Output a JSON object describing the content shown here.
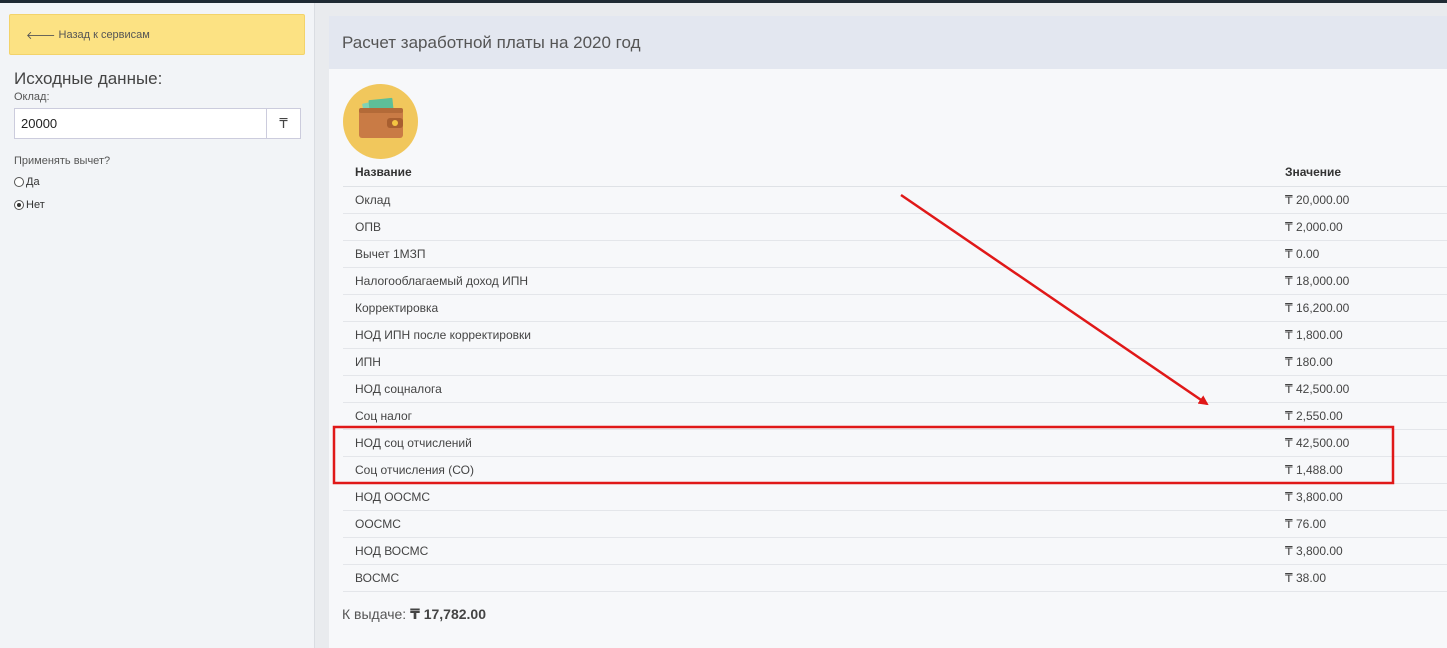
{
  "sidebar": {
    "back_label": "Назад к сервисам",
    "back_icon": "arrow-left-icon",
    "section_title": "Исходные данные:",
    "salary_label": "Оклад:",
    "salary_value": "20000",
    "currency_symbol": "₸",
    "deduction_question": "Применять вычет?",
    "options": [
      {
        "label": "Да",
        "checked": false
      },
      {
        "label": "Нет",
        "checked": true
      }
    ]
  },
  "main": {
    "title": "Расчет заработной платы на 2020 год",
    "icon": "wallet-icon",
    "table": {
      "headers": [
        "Название",
        "Значение"
      ],
      "rows": [
        {
          "name": "Оклад",
          "value": "₸ 20,000.00"
        },
        {
          "name": "ОПВ",
          "value": "₸ 2,000.00"
        },
        {
          "name": "Вычет 1МЗП",
          "value": "₸ 0.00"
        },
        {
          "name": "Налогооблагаемый доход ИПН",
          "value": "₸ 18,000.00"
        },
        {
          "name": "Корректировка",
          "value": "₸ 16,200.00"
        },
        {
          "name": "НОД ИПН после корректировки",
          "value": "₸ 1,800.00"
        },
        {
          "name": "ИПН",
          "value": "₸ 180.00"
        },
        {
          "name": "НОД соцналога",
          "value": "₸ 42,500.00"
        },
        {
          "name": "Соц налог",
          "value": "₸ 2,550.00"
        },
        {
          "name": "НОД соц отчислений",
          "value": "₸ 42,500.00"
        },
        {
          "name": "Соц отчисления (СО)",
          "value": "₸ 1,488.00"
        },
        {
          "name": "НОД ООСМС",
          "value": "₸ 3,800.00"
        },
        {
          "name": "ООСМС",
          "value": "₸ 76.00"
        },
        {
          "name": "НОД ВОСМС",
          "value": "₸ 3,800.00"
        },
        {
          "name": "ВОСМС",
          "value": "₸ 38.00"
        }
      ]
    },
    "total_label": "К выдаче:",
    "total_value": "₸ 17,782.00"
  },
  "annotation": {
    "color": "#e01818"
  }
}
